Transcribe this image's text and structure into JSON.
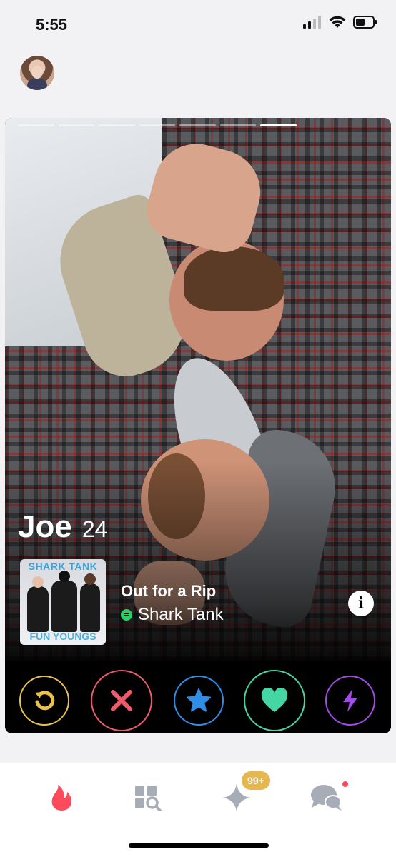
{
  "status_bar": {
    "time": "5:55",
    "icons": [
      "cellular-signal-icon",
      "wifi-icon",
      "battery-icon"
    ]
  },
  "header": {
    "avatar": "profile-avatar"
  },
  "card": {
    "photo_count": 7,
    "active_photo_index": 6,
    "name": "Joe",
    "age": "24",
    "anthem": {
      "album_top_text": "SHARK TANK",
      "album_bottom_text": "FUN YOUNGS",
      "track_title": "Out for a Rip",
      "artist": "Shark Tank",
      "service_icon": "spotify-icon"
    },
    "info_label": "i"
  },
  "actions": [
    {
      "name": "rewind",
      "icon": "undo-icon",
      "color": "#e8c24d"
    },
    {
      "name": "nope",
      "icon": "x-icon",
      "color": "#ef5a6a"
    },
    {
      "name": "super-like",
      "icon": "star-icon",
      "color": "#2f8fe8"
    },
    {
      "name": "like",
      "icon": "heart-icon",
      "color": "#45d6a5"
    },
    {
      "name": "boost",
      "icon": "lightning-icon",
      "color": "#a24be6"
    }
  ],
  "bottom_nav": {
    "items": [
      {
        "name": "home",
        "icon": "flame-icon",
        "active": true,
        "color": "#fe4a5a"
      },
      {
        "name": "explore",
        "icon": "grid-search-icon",
        "active": false
      },
      {
        "name": "likes",
        "icon": "sparkle-icon",
        "active": false,
        "badge": "99+"
      },
      {
        "name": "messages",
        "icon": "chat-bubbles-icon",
        "active": false,
        "notification_dot": true
      }
    ]
  },
  "colors": {
    "brand": "#fe4a5a",
    "badge": "#e6b74f",
    "inactive_nav": "#a7adb7"
  }
}
